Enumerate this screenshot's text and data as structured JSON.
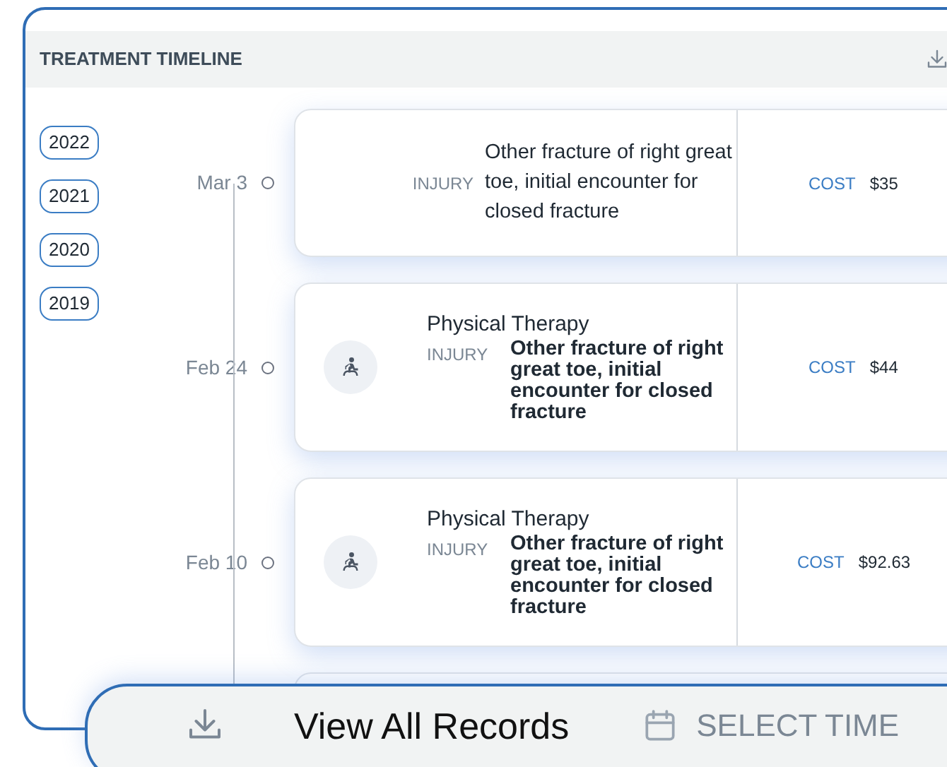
{
  "header": {
    "title": "TREATMENT TIMELINE"
  },
  "years": [
    "2022",
    "2021",
    "2020",
    "2019"
  ],
  "entries": [
    {
      "kind": "plain",
      "date": "Mar 3",
      "label": "INJURY",
      "description": "Other fracture of right great toe, initial encounter for closed fracture",
      "cost_label": "COST",
      "cost": "$35"
    },
    {
      "kind": "therapy",
      "date": "Feb 24",
      "title": "Physical Therapy",
      "label": "INJURY",
      "description": "Other fracture of right great toe, initial encounter for closed fracture",
      "cost_label": "COST",
      "cost": "$44"
    },
    {
      "kind": "therapy",
      "date": "Feb 10",
      "title": "Physical Therapy",
      "label": "INJURY",
      "description": "Other fracture of right great toe, initial encounter for closed fracture",
      "cost_label": "COST",
      "cost": "$92.63"
    }
  ],
  "footer": {
    "primary": "View All Records",
    "secondary": "SELECT TIME"
  }
}
